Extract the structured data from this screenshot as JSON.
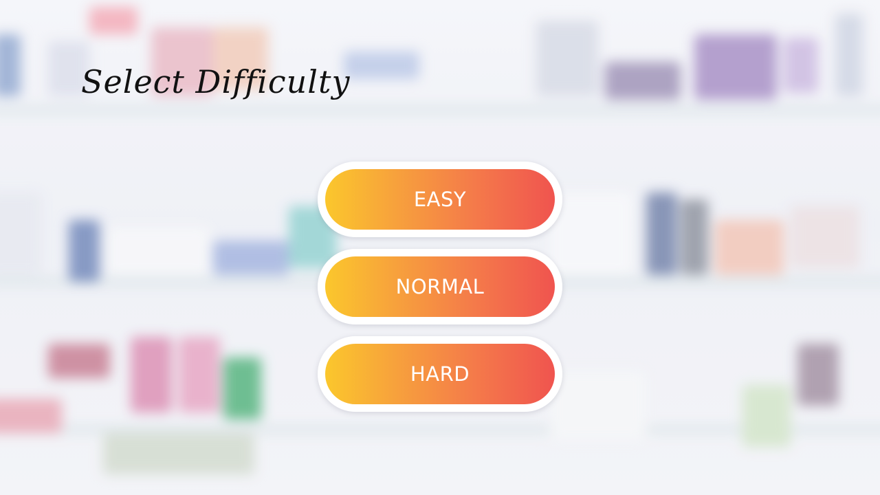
{
  "title": "Select Difficulty",
  "buttons": [
    {
      "label": "EASY"
    },
    {
      "label": "NORMAL"
    },
    {
      "label": "HARD"
    }
  ],
  "colors": {
    "button_gradient_start": "#fbc72c",
    "button_gradient_end": "#f0544f",
    "button_border": "#ffffff",
    "button_text": "#ffffff",
    "title": "#111111"
  }
}
